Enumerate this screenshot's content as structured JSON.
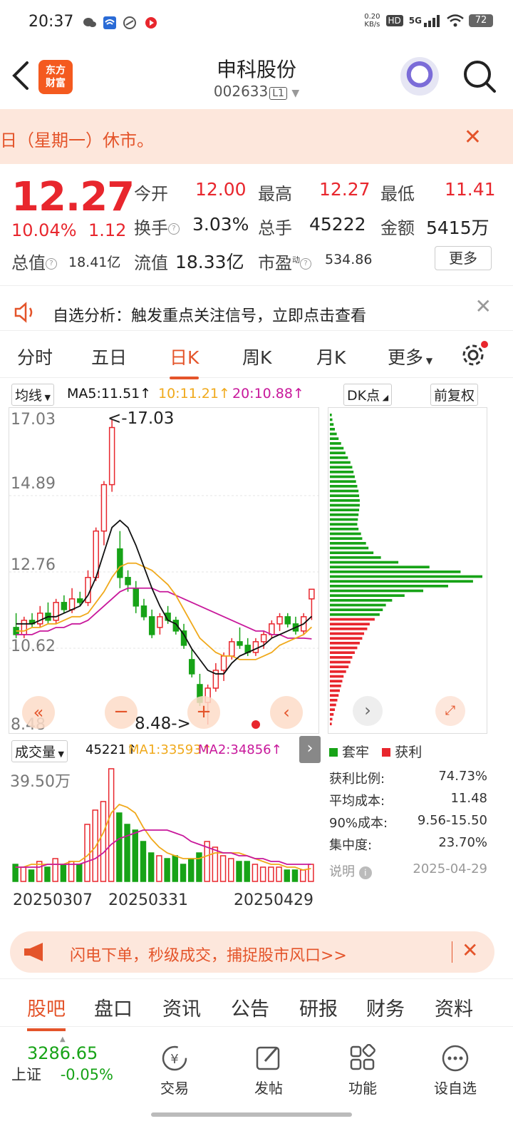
{
  "status": {
    "time": "20:37",
    "net_speed_value": "0.20",
    "net_speed_unit": "KB/s",
    "hd": "HD",
    "network": "5G",
    "battery": "72"
  },
  "header": {
    "logo_line1": "东方",
    "logo_line2": "财富",
    "name": "申科股份",
    "code": "002633",
    "level": "L1"
  },
  "notice": {
    "text": "日（星期一）休市。"
  },
  "quote": {
    "price": "12.27",
    "change_pct": "10.04%",
    "change_amt": "1.12",
    "open_label": "今开",
    "open": "12.00",
    "high_label": "最高",
    "high": "12.27",
    "low_label": "最低",
    "low": "11.41",
    "turnover_label": "换手",
    "turnover": "3.03%",
    "volume_label": "总手",
    "volume": "45222",
    "amount_label": "金额",
    "amount": "5415万",
    "mcap_label": "总值",
    "mcap": "18.41亿",
    "float_label": "流值",
    "float": "18.33亿",
    "pe_label": "市盈",
    "pe_sup": "动",
    "pe": "534.86",
    "more": "更多"
  },
  "analysis": {
    "text": "自选分析：触发重点关注信号，立即点击查看"
  },
  "chart_tabs": [
    "分时",
    "五日",
    "日K",
    "周K",
    "月K",
    "更多"
  ],
  "ma": {
    "selector": "均线",
    "ma5": "MA5:11.51↑",
    "ma10": "10:11.21↑",
    "ma20": "20:10.88↑",
    "dk": "DK点",
    "adjust": "前复权"
  },
  "kline": {
    "y_ticks": [
      "17.03",
      "14.89",
      "12.76",
      "10.62",
      "8.48"
    ],
    "max_label": "<-17.03",
    "min_label": "8.48->"
  },
  "volume_row": {
    "selector": "成交量",
    "vol": "45221↑",
    "ma1": "MA1:33593↑",
    "ma2": "MA2:34856↑",
    "max_label": "39.50万"
  },
  "dates": [
    "20250307",
    "20250331",
    "20250429"
  ],
  "chips": {
    "legend_trapped": "套牢",
    "legend_profit": "获利",
    "rows": [
      {
        "label": "获利比例:",
        "value": "74.73%"
      },
      {
        "label": "平均成本:",
        "value": "11.48"
      },
      {
        "label": "90%成本:",
        "value": "9.56-15.50"
      },
      {
        "label": "集中度:",
        "value": "23.70%"
      }
    ],
    "explain": "说明",
    "date": "2025-04-29"
  },
  "promo": {
    "text": "闪电下单，秒级成交，捕捉股市风口>>"
  },
  "info_tabs": [
    "股吧",
    "盘口",
    "资讯",
    "公告",
    "研报",
    "财务",
    "资料"
  ],
  "bottom": {
    "index_value": "3286.65",
    "index_name": "上证",
    "index_chg": "-0.05%",
    "trade": "交易",
    "post": "发帖",
    "func": "功能",
    "watch": "设自选"
  },
  "colors": {
    "up": "#e8262d",
    "down": "#17a317",
    "accent": "#e4542a",
    "ma5": "#111111",
    "ma10": "#f0a91b",
    "ma20": "#c8189b"
  },
  "chart_data": {
    "type": "candlestick",
    "y_range": [
      8.48,
      17.03
    ],
    "candles": [
      [
        11.2,
        11.6,
        10.9,
        11.0
      ],
      [
        11.0,
        11.5,
        10.9,
        11.4
      ],
      [
        11.4,
        11.6,
        11.2,
        11.3
      ],
      [
        11.3,
        11.8,
        11.2,
        11.6
      ],
      [
        11.6,
        11.9,
        11.3,
        11.4
      ],
      [
        11.4,
        12.0,
        11.3,
        11.9
      ],
      [
        11.9,
        12.1,
        11.6,
        11.7
      ],
      [
        11.7,
        12.3,
        11.6,
        12.0
      ],
      [
        12.0,
        12.2,
        11.8,
        11.9
      ],
      [
        11.9,
        12.8,
        11.8,
        12.6
      ],
      [
        12.6,
        14.0,
        12.5,
        13.9
      ],
      [
        13.9,
        15.3,
        13.5,
        15.2
      ],
      [
        15.2,
        17.03,
        15.0,
        16.8
      ],
      [
        13.4,
        13.9,
        12.3,
        12.6
      ],
      [
        12.6,
        12.8,
        12.2,
        12.4
      ],
      [
        12.3,
        12.5,
        11.6,
        11.8
      ],
      [
        11.8,
        12.0,
        11.4,
        11.5
      ],
      [
        11.5,
        11.7,
        10.9,
        11.0
      ],
      [
        11.2,
        11.6,
        11.0,
        11.5
      ],
      [
        11.6,
        11.8,
        11.3,
        11.4
      ],
      [
        11.4,
        11.5,
        11.0,
        11.1
      ],
      [
        11.1,
        11.3,
        10.6,
        10.7
      ],
      [
        10.3,
        10.6,
        9.8,
        9.9
      ],
      [
        9.6,
        9.9,
        9.0,
        9.1
      ],
      [
        9.1,
        9.6,
        8.48,
        9.5
      ],
      [
        9.5,
        10.2,
        9.4,
        10.0
      ],
      [
        10.0,
        10.5,
        9.7,
        10.4
      ],
      [
        10.4,
        10.9,
        10.3,
        10.8
      ],
      [
        10.8,
        11.2,
        10.6,
        10.7
      ],
      [
        10.7,
        10.9,
        10.4,
        10.5
      ],
      [
        10.5,
        10.9,
        10.4,
        10.8
      ],
      [
        10.8,
        11.1,
        10.6,
        11.0
      ],
      [
        11.0,
        11.4,
        10.9,
        11.3
      ],
      [
        11.3,
        11.6,
        11.1,
        11.5
      ],
      [
        11.5,
        11.6,
        11.2,
        11.3
      ],
      [
        11.3,
        11.5,
        11.0,
        11.1
      ],
      [
        11.1,
        11.6,
        11.0,
        11.5
      ],
      [
        12.0,
        12.27,
        11.41,
        12.27
      ]
    ],
    "ma5": [
      11.3,
      11.3,
      11.3,
      11.4,
      11.5,
      11.5,
      11.6,
      11.7,
      11.8,
      12.1,
      12.6,
      13.3,
      14.0,
      14.2,
      14.0,
      13.5,
      12.9,
      12.3,
      11.8,
      11.4,
      11.3,
      11.0,
      10.6,
      10.3,
      10.0,
      9.9,
      9.9,
      10.2,
      10.4,
      10.5,
      10.6,
      10.7,
      10.9,
      11.0,
      11.1,
      11.2,
      11.3,
      11.51
    ],
    "ma10": [
      11.1,
      11.1,
      11.2,
      11.2,
      11.3,
      11.3,
      11.4,
      11.5,
      11.5,
      11.6,
      11.9,
      12.2,
      12.6,
      12.9,
      13.0,
      13.0,
      12.9,
      12.8,
      12.6,
      12.4,
      12.1,
      11.7,
      11.3,
      10.9,
      10.7,
      10.5,
      10.4,
      10.4,
      10.3,
      10.3,
      10.3,
      10.4,
      10.5,
      10.7,
      10.8,
      10.9,
      11.0,
      11.21
    ],
    "ma20": [
      11.0,
      11.0,
      11.0,
      11.1,
      11.1,
      11.2,
      11.2,
      11.3,
      11.3,
      11.4,
      11.6,
      11.8,
      12.0,
      12.2,
      12.3,
      12.3,
      12.3,
      12.3,
      12.2,
      12.2,
      12.1,
      12.0,
      11.9,
      11.8,
      11.7,
      11.6,
      11.5,
      11.4,
      11.3,
      11.2,
      11.1,
      11.1,
      11.0,
      11.0,
      10.9,
      10.9,
      10.9,
      10.88
    ],
    "volumes": [
      6,
      5,
      4,
      7,
      5,
      8,
      6,
      7,
      6,
      20,
      25,
      28,
      39.5,
      24,
      20,
      18,
      14,
      10,
      9,
      8,
      9,
      6,
      8,
      10,
      14,
      12,
      9,
      8,
      7,
      7,
      6,
      5,
      5,
      5,
      4,
      4,
      4,
      6
    ],
    "vol_ma1": [
      5,
      5,
      6,
      6,
      6,
      6,
      6,
      7,
      7,
      9,
      12,
      17,
      24,
      27,
      26,
      24,
      19,
      15,
      12,
      10,
      9,
      8,
      8,
      8,
      9,
      10,
      10,
      10,
      10,
      9,
      8,
      7,
      6,
      6,
      5,
      5,
      4,
      4.5
    ],
    "vol_ma2": [
      5,
      5,
      5,
      5,
      6,
      6,
      6,
      6,
      6,
      7,
      8,
      10,
      13,
      15,
      16,
      17,
      18,
      18,
      18,
      18,
      17,
      16,
      14,
      13,
      12,
      11,
      10,
      10,
      9,
      9,
      8,
      8,
      7,
      7,
      6,
      6,
      6,
      6
    ],
    "chip_profile": [
      3,
      4,
      6,
      8,
      11,
      14,
      18,
      22,
      25,
      29,
      33,
      36,
      38,
      40,
      42,
      44,
      46,
      47,
      48,
      48,
      47,
      46,
      45,
      44,
      46,
      50,
      52,
      58,
      62,
      70,
      82,
      110,
      160,
      210,
      245,
      230,
      190,
      150,
      120,
      100,
      90,
      85,
      80,
      72,
      64,
      60,
      55,
      52,
      48,
      44,
      40,
      36,
      33,
      30,
      26,
      22,
      20,
      18,
      16,
      14,
      12,
      10,
      8,
      6,
      4,
      3
    ]
  }
}
